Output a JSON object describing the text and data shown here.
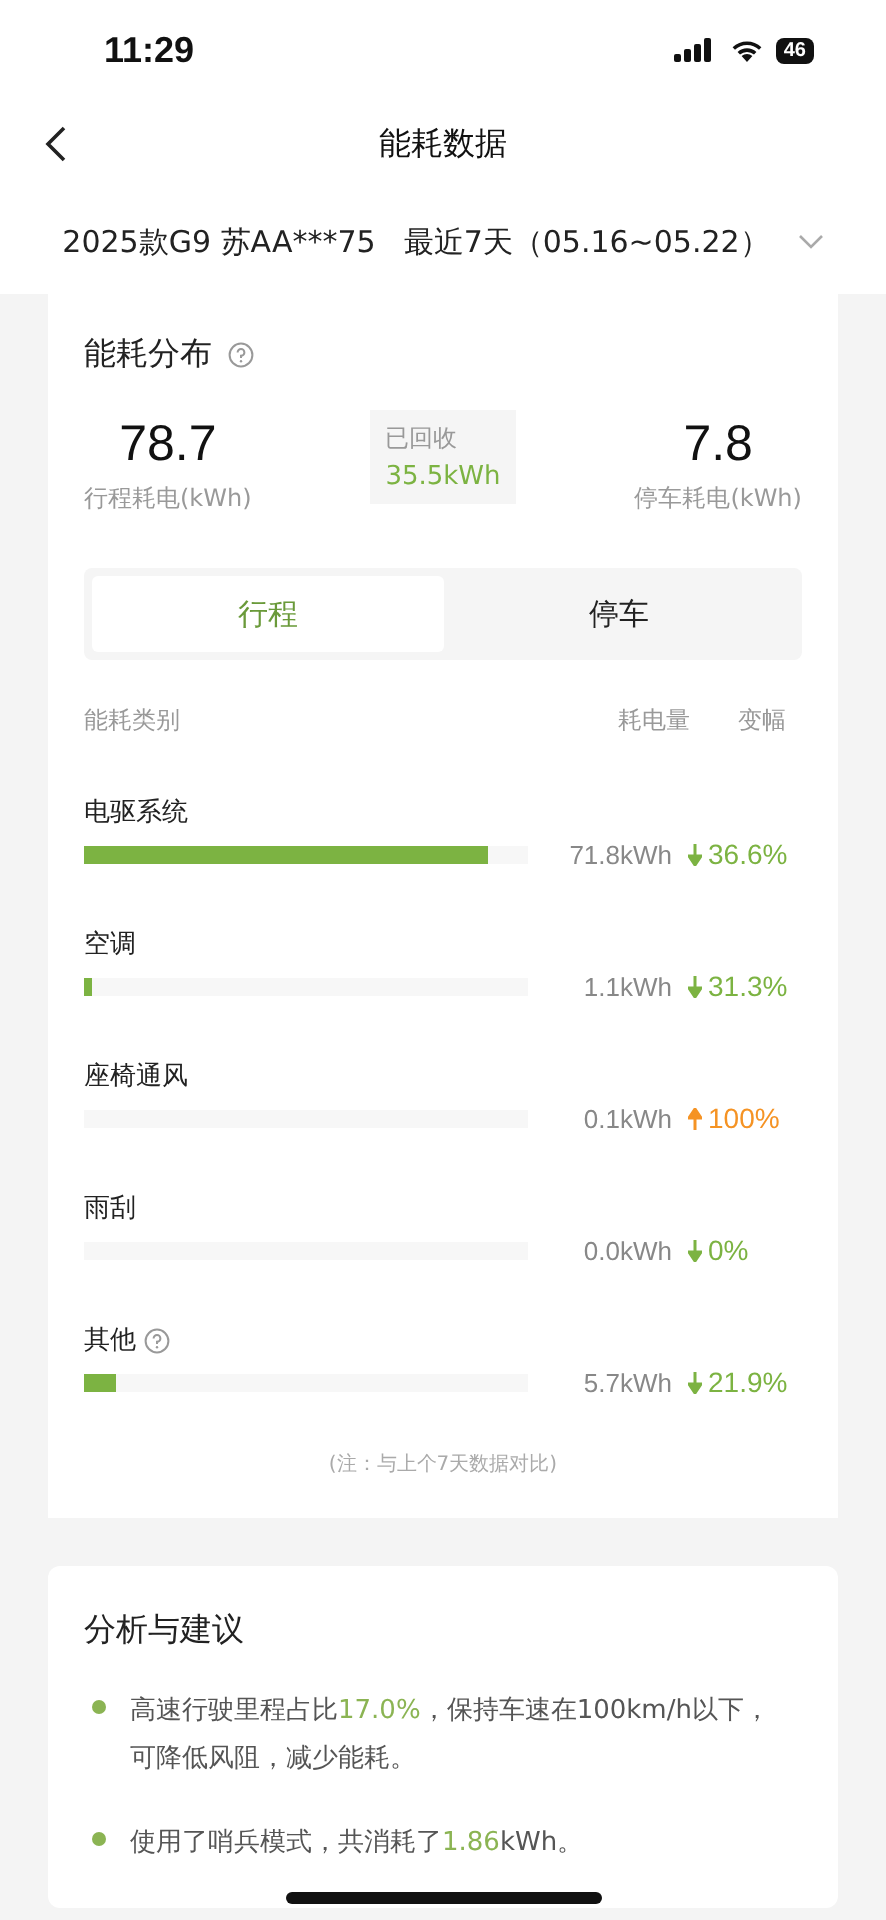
{
  "status_bar": {
    "time": "11:29",
    "battery": "46"
  },
  "nav": {
    "title": "能耗数据"
  },
  "selector": {
    "vehicle": "2025款G9 苏AA***75",
    "period": "最近7天（05.16~05.22）"
  },
  "distribution": {
    "title": "能耗分布",
    "trip": {
      "value": "78.7",
      "label": "行程耗电(kWh)"
    },
    "recovered": {
      "label": "已回收",
      "value": "35.5kWh"
    },
    "parking": {
      "value": "7.8",
      "label": "停车耗电(kWh)"
    },
    "tabs": [
      {
        "label": "行程",
        "selected": true
      },
      {
        "label": "停车",
        "selected": false
      }
    ],
    "columns": [
      "能耗类别",
      "耗电量",
      "变幅"
    ],
    "rows": [
      {
        "name": "电驱系统",
        "help": false,
        "level": 0.91,
        "amount": "71.8kWh",
        "increase": false,
        "change": "36.6%"
      },
      {
        "name": "空调",
        "help": false,
        "level": 0.02,
        "amount": "1.1kWh",
        "increase": false,
        "change": "31.3%"
      },
      {
        "name": "座椅通风",
        "help": false,
        "level": 0,
        "amount": "0.1kWh",
        "increase": true,
        "change": "100%"
      },
      {
        "name": "雨刮",
        "help": false,
        "level": 0,
        "amount": "0.0kWh",
        "increase": false,
        "change": "0%"
      },
      {
        "name": "其他",
        "help": true,
        "level": 0.07,
        "amount": "5.7kWh",
        "increase": false,
        "change": "21.9%"
      }
    ],
    "note": "(注：与上个7天数据对比)"
  },
  "advice": {
    "title": "分析与建议",
    "items": [
      [
        {
          "text": "高速行驶里程占比",
          "kind": "plain"
        },
        {
          "text": "17.0%",
          "kind": "highlight"
        },
        {
          "text": "，保持车速在100km/h以下，可降低风阻，减少能耗。",
          "kind": "plain"
        }
      ],
      [
        {
          "text": "使用了哨兵模式，共消耗了",
          "kind": "plain"
        },
        {
          "text": "1.86",
          "kind": "highlight"
        },
        {
          "text": "kWh。",
          "kind": "plain"
        }
      ]
    ]
  }
}
